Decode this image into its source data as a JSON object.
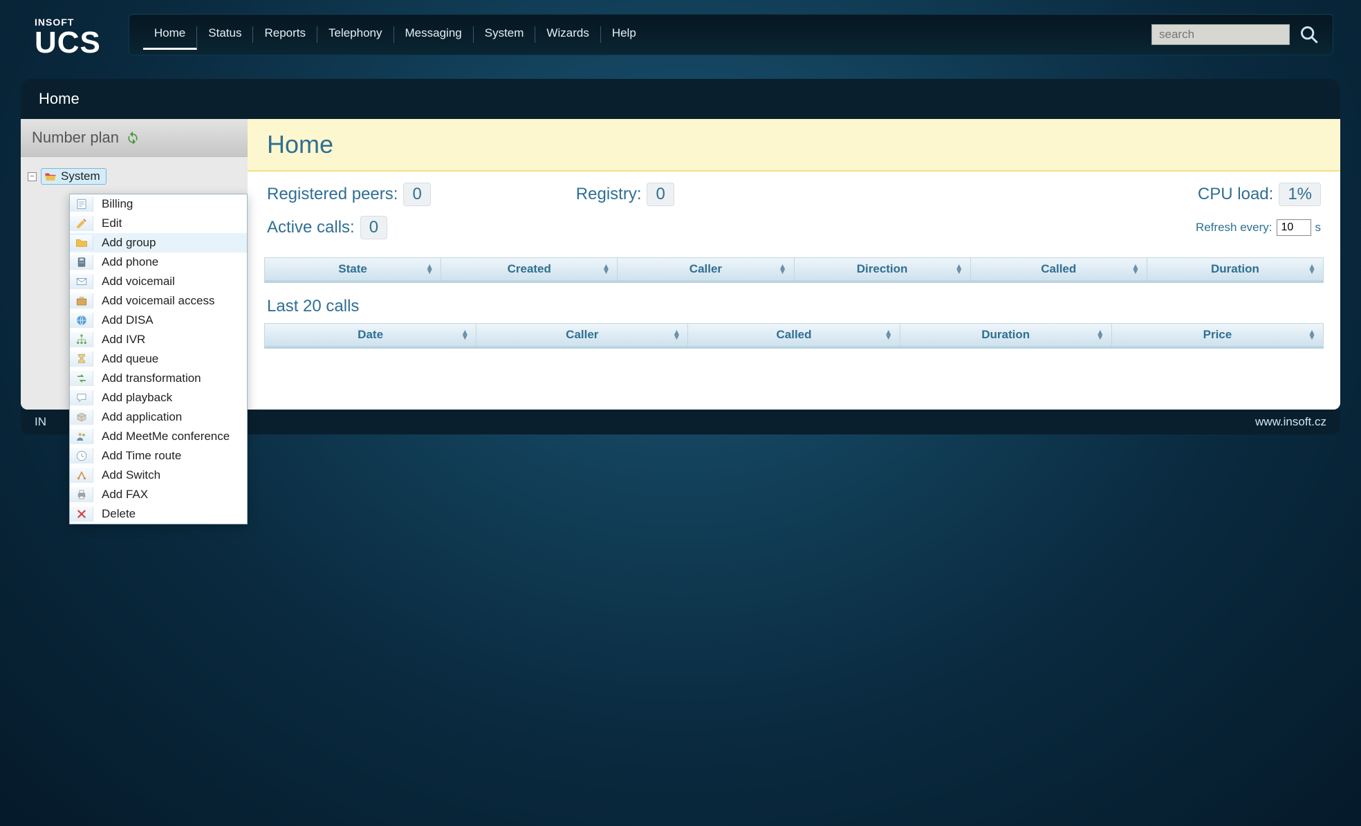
{
  "brand": {
    "top": "INSOFT",
    "main": "UCS"
  },
  "nav": {
    "items": [
      "Home",
      "Status",
      "Reports",
      "Telephony",
      "Messaging",
      "System",
      "Wizards",
      "Help"
    ],
    "active": "Home"
  },
  "search": {
    "placeholder": "search"
  },
  "breadcrumb": "Home",
  "sidebar": {
    "title": "Number plan",
    "root_node": "System",
    "context_menu": [
      {
        "icon": "billing",
        "label": "Billing"
      },
      {
        "icon": "edit",
        "label": "Edit"
      },
      {
        "icon": "folder-add",
        "label": "Add group"
      },
      {
        "icon": "phone",
        "label": "Add phone"
      },
      {
        "icon": "mail",
        "label": "Add voicemail"
      },
      {
        "icon": "briefcase",
        "label": "Add voicemail access"
      },
      {
        "icon": "globe",
        "label": "Add DISA"
      },
      {
        "icon": "tree",
        "label": "Add IVR"
      },
      {
        "icon": "hourglass",
        "label": "Add queue"
      },
      {
        "icon": "transform",
        "label": "Add transformation"
      },
      {
        "icon": "bubble",
        "label": "Add playback"
      },
      {
        "icon": "package",
        "label": "Add application"
      },
      {
        "icon": "users",
        "label": "Add MeetMe conference"
      },
      {
        "icon": "clock",
        "label": "Add Time route"
      },
      {
        "icon": "switch",
        "label": "Add Switch"
      },
      {
        "icon": "printer",
        "label": "Add FAX"
      },
      {
        "icon": "delete",
        "label": "Delete"
      }
    ],
    "hovered_index": 2
  },
  "page": {
    "title": "Home",
    "stats": {
      "registered_peers_label": "Registered peers:",
      "registered_peers_value": "0",
      "registry_label": "Registry:",
      "registry_value": "0",
      "cpu_label": "CPU load:",
      "cpu_value": "1%",
      "active_calls_label": "Active calls:",
      "active_calls_value": "0",
      "refresh_label": "Refresh every:",
      "refresh_value": "10",
      "refresh_unit": "s"
    },
    "active_calls_columns": [
      "State",
      "Created",
      "Caller",
      "Direction",
      "Called",
      "Duration"
    ],
    "last_calls_title": "Last 20 calls",
    "last_calls_columns": [
      "Date",
      "Caller",
      "Called",
      "Duration",
      "Price"
    ]
  },
  "footer": {
    "left_prefix": "IN",
    "right": "www.insoft.cz"
  }
}
